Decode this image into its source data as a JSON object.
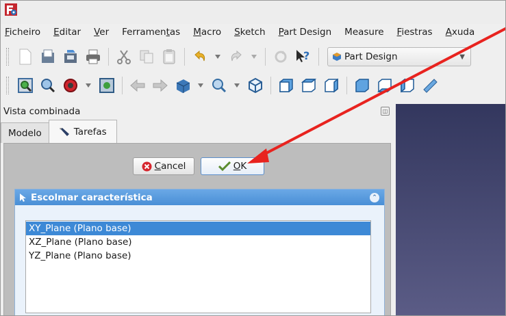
{
  "menu": {
    "items": [
      {
        "pre": "",
        "u": "F",
        "post": "icheiro"
      },
      {
        "pre": "",
        "u": "E",
        "post": "ditar"
      },
      {
        "pre": "",
        "u": "V",
        "post": "er"
      },
      {
        "pre": "Ferramen",
        "u": "t",
        "post": "as"
      },
      {
        "pre": "",
        "u": "M",
        "post": "acro"
      },
      {
        "pre": "",
        "u": "S",
        "post": "ketch"
      },
      {
        "pre": "",
        "u": "P",
        "post": "art Design"
      },
      {
        "pre": "Measure",
        "u": "",
        "post": ""
      },
      {
        "pre": "",
        "u": "F",
        "post": "iestras"
      },
      {
        "pre": "",
        "u": "A",
        "post": "xuda"
      }
    ]
  },
  "toolbar": {
    "workbench": "Part Design"
  },
  "combo_view": {
    "title": "Vista combinada",
    "tabs": [
      "Modelo",
      "Tarefas"
    ]
  },
  "task": {
    "cancel_mnemonic": "C",
    "cancel_rest": "ancel",
    "ok_mnemonic": "O",
    "ok_rest": "K",
    "panel_title": "Escolmar característica",
    "features": [
      "XY_Plane (Plano base)",
      "XZ_Plane (Plano base)",
      "YZ_Plane (Plano base)"
    ],
    "selected_index": 0
  },
  "colors": {
    "annotation": "#e8231f",
    "selection": "#3d89d6",
    "panel_header": "#4a8fd6",
    "view_background": "#3a3d66"
  }
}
